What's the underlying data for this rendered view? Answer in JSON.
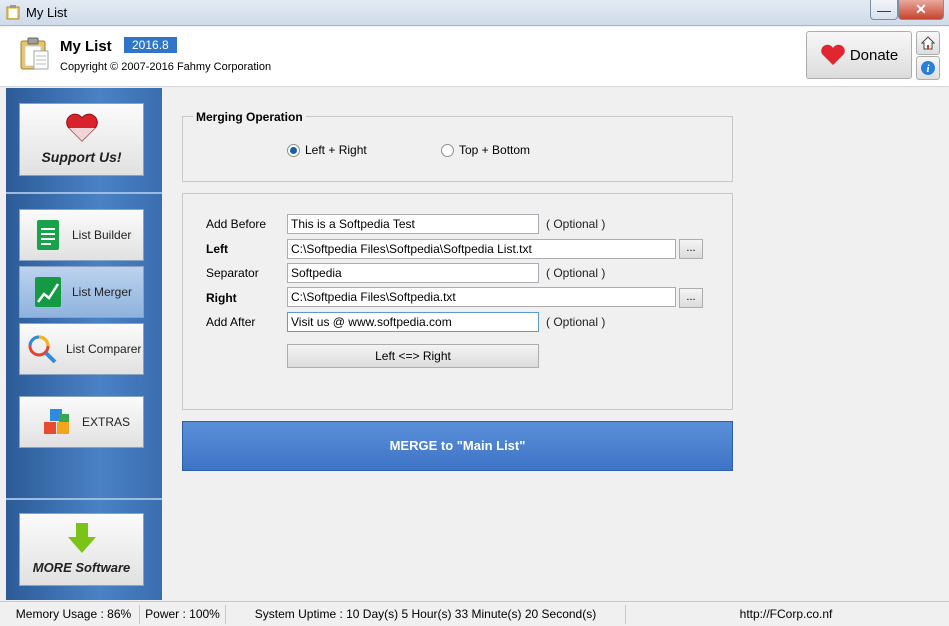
{
  "window": {
    "title": "My List"
  },
  "header": {
    "app_name": "My List",
    "version": "2016.8",
    "copyright": "Copyright © 2007-2016 Fahmy Corporation",
    "donate_label": "Donate"
  },
  "sidebar": {
    "support_label": "Support Us!",
    "items": [
      {
        "label": "List Builder"
      },
      {
        "label": "List Merger"
      },
      {
        "label": "List Comparer"
      },
      {
        "label": "EXTRAS"
      }
    ],
    "more_label": "MORE Software"
  },
  "merging": {
    "legend": "Merging Operation",
    "option_left_right": "Left + Right",
    "option_top_bottom": "Top + Bottom",
    "selected": "Left + Right"
  },
  "form": {
    "add_before_label": "Add Before",
    "add_before_value": "This is a Softpedia Test",
    "left_label": "Left",
    "left_value": "C:\\Softpedia Files\\Softpedia\\Softpedia List.txt",
    "separator_label": "Separator",
    "separator_value": "Softpedia",
    "right_label": "Right",
    "right_value": "C:\\Softpedia Files\\Softpedia.txt",
    "add_after_label": "Add After",
    "add_after_value": "Visit us @ www.softpedia.com",
    "optional_text": "( Optional )",
    "browse_label": "...",
    "swap_label": "Left <=> Right"
  },
  "merge_button": {
    "label": "MERGE to \"Main List\""
  },
  "status": {
    "memory": "Memory Usage : 86%",
    "power": "Power : 100%",
    "uptime": "System Uptime : 10 Day(s) 5 Hour(s) 33 Minute(s) 20 Second(s)",
    "url": "http://FCorp.co.nf"
  },
  "colors": {
    "accent": "#2f76c9",
    "merge": "#4a7fd0",
    "sidebar": "#3a6eb0"
  }
}
